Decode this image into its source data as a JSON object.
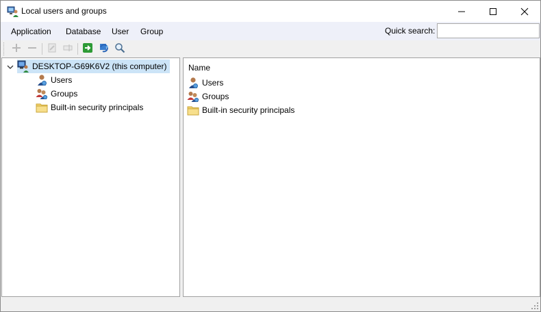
{
  "window": {
    "title": "Local users and groups",
    "icon": "users-computer-icon"
  },
  "menubar": {
    "items": [
      "Application",
      "Database",
      "User",
      "Group"
    ],
    "quick_search_label": "Quick search:",
    "quick_search_value": "",
    "quick_search_placeholder": ""
  },
  "toolbar": {
    "buttons": [
      {
        "icon": "add-icon",
        "enabled": false
      },
      {
        "icon": "remove-icon",
        "enabled": false
      },
      {
        "icon": "edit-icon",
        "enabled": false
      },
      {
        "icon": "rename-icon",
        "enabled": false
      },
      {
        "icon": "export-arrow-icon",
        "enabled": true
      },
      {
        "icon": "refresh-icon",
        "enabled": true
      },
      {
        "icon": "search-icon",
        "enabled": true
      }
    ]
  },
  "tree": {
    "root_label": "DESKTOP-G69K6V2 (this computer)",
    "root_expanded": true,
    "children": [
      {
        "label": "Users",
        "icon": "user-icon"
      },
      {
        "label": "Groups",
        "icon": "group-icon"
      },
      {
        "label": "Built-in security principals",
        "icon": "folder-icon"
      }
    ]
  },
  "list": {
    "column_header": "Name",
    "items": [
      {
        "label": "Users",
        "icon": "user-icon"
      },
      {
        "label": "Groups",
        "icon": "group-icon"
      },
      {
        "label": "Built-in security principals",
        "icon": "folder-icon"
      }
    ]
  },
  "colors": {
    "menubar_bg": "#eef0f9",
    "selection_bg": "#cce4f7",
    "folder_yellow": "#f3d16b"
  }
}
